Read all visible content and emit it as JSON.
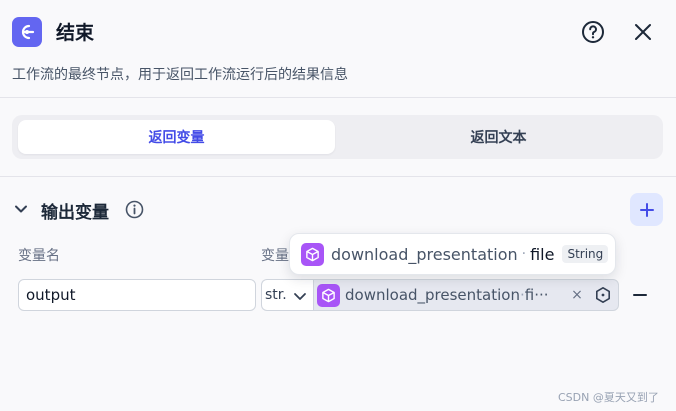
{
  "header": {
    "title": "结束",
    "description": "工作流的最终节点，用于返回工作流运行后的结果信息"
  },
  "tabs": [
    {
      "label": "返回变量",
      "active": true
    },
    {
      "label": "返回文本",
      "active": false
    }
  ],
  "output_section": {
    "title": "输出变量",
    "columns": {
      "name": "变量名",
      "variable": "变量"
    },
    "rows": [
      {
        "name": "output",
        "type": "str.",
        "variable_node": "download_presentation",
        "variable_field": "fi···"
      }
    ]
  },
  "tooltip": {
    "node": "download_presentation",
    "separator": "·",
    "field": "file",
    "type": "String"
  },
  "icons": {
    "node": "end-node-icon",
    "help": "help-circle-icon",
    "close": "close-icon",
    "collapse": "chevron-down-icon",
    "info": "info-circle-icon",
    "add": "plus-icon",
    "var": "cube-icon",
    "remove": "minus-icon"
  },
  "colors": {
    "accent": "#444ce7",
    "node_icon_bg": "#6366f1",
    "var_icon_bg": "#a855f7"
  },
  "watermark": "CSDN @夏天又到了"
}
